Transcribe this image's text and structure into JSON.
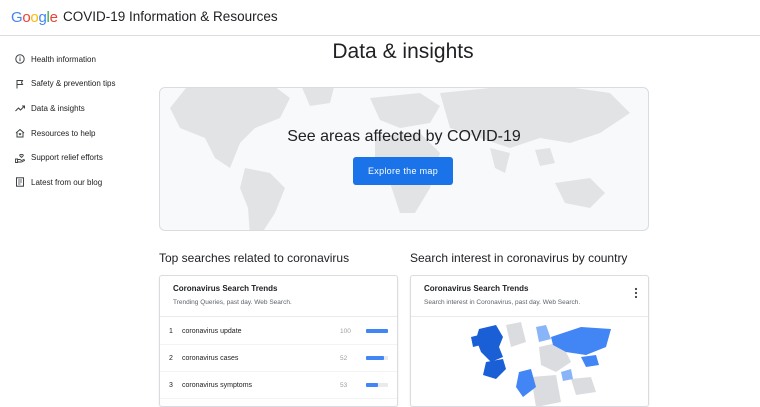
{
  "header": {
    "logo_text": "Google",
    "title": "COVID-19 Information & Resources"
  },
  "sidebar": {
    "items": [
      {
        "label": "Health information",
        "icon": "info-icon"
      },
      {
        "label": "Safety & prevention tips",
        "icon": "flag-icon"
      },
      {
        "label": "Data & insights",
        "icon": "trending-up-icon"
      },
      {
        "label": "Resources to help",
        "icon": "house-heart-icon"
      },
      {
        "label": "Support relief efforts",
        "icon": "hand-heart-icon"
      },
      {
        "label": "Latest from our blog",
        "icon": "article-icon"
      }
    ]
  },
  "main": {
    "page_title": "Data & insights",
    "map_card": {
      "headline": "See areas affected by COVID-19",
      "button_label": "Explore the map"
    },
    "searches": {
      "heading": "Top searches related to coronavirus",
      "card_title": "Coronavirus Search Trends",
      "card_subtitle": "Trending Queries, past day. Web Search.",
      "rows": [
        {
          "rank": "1",
          "term": "coronavirus update",
          "value": "100",
          "level": 1.0
        },
        {
          "rank": "2",
          "term": "coronavirus cases",
          "value": "52",
          "level": 0.82
        },
        {
          "rank": "3",
          "term": "coronavirus symptoms",
          "value": "53",
          "level": 0.55
        }
      ]
    },
    "interest": {
      "heading": "Search interest in coronavirus by country",
      "card_title": "Coronavirus Search Trends",
      "card_subtitle": "Search interest in Coronavirus, past day. Web Search."
    }
  },
  "colors": {
    "accent": "#1a73e8",
    "bar": "#4285f4",
    "map_light": "#dadce0",
    "map_dark": "#1a5fd6"
  }
}
